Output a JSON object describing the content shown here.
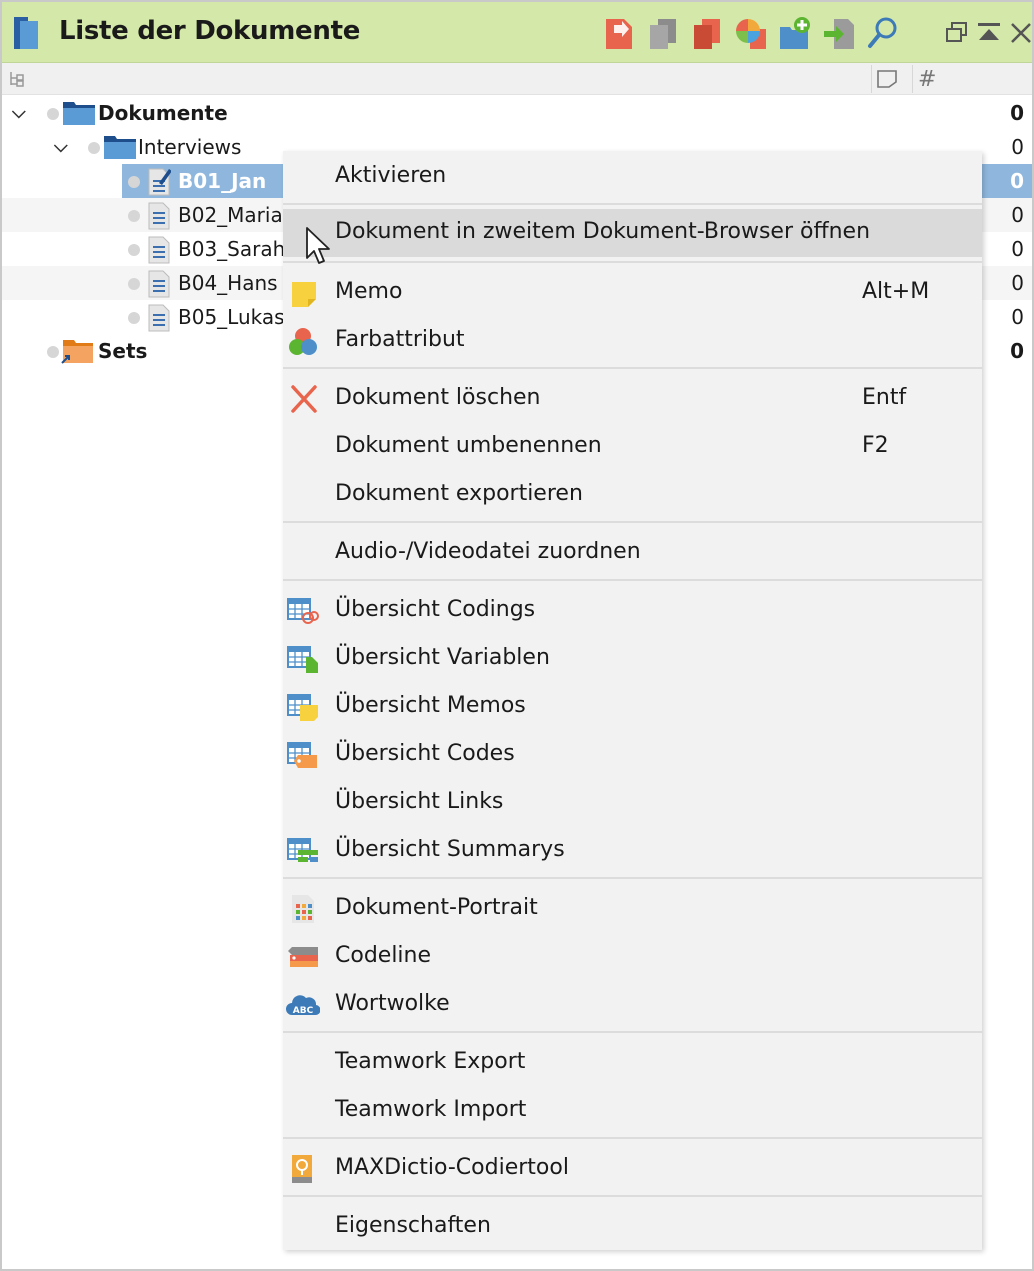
{
  "window": {
    "title": "Liste der Dokumente",
    "toolbar_icons": [
      "import-docs-icon",
      "copy-docs-icon",
      "duplicate-docs-icon",
      "document-portrait-chart-icon",
      "new-document-group-icon",
      "import-arrow-icon",
      "search-icon"
    ],
    "window_icons": [
      "restore-window-icon",
      "collapse-up-icon",
      "close-icon"
    ]
  },
  "columns": {
    "tree_icon": "tree-structure-icon",
    "memo_icon": "memo-column-icon",
    "count_icon": "#"
  },
  "tree": {
    "root": {
      "label": "Dokumente",
      "count": "0"
    },
    "group": {
      "label": "Interviews",
      "count": "0"
    },
    "documents": [
      {
        "label": "B01_Jan",
        "count": "0",
        "selected": true
      },
      {
        "label": "B02_Maria",
        "count": "0"
      },
      {
        "label": "B03_Sarah",
        "count": "0"
      },
      {
        "label": "B04_Hans",
        "count": "0"
      },
      {
        "label": "B05_Lukas",
        "count": "0"
      }
    ],
    "sets": {
      "label": "Sets",
      "count": "0"
    }
  },
  "menu": {
    "items": [
      {
        "label": "Aktivieren",
        "shortcut": "",
        "icon": ""
      },
      {
        "label": "Dokument in zweitem Dokument-Browser öffnen",
        "shortcut": "",
        "icon": "",
        "hover": true
      },
      {
        "label": "Memo",
        "shortcut": "Alt+M",
        "icon": "memo-icon"
      },
      {
        "label": "Farbattribut",
        "shortcut": "",
        "icon": "color-attribute-icon"
      },
      {
        "label": "Dokument löschen",
        "shortcut": "Entf",
        "icon": "delete-icon"
      },
      {
        "label": "Dokument umbenennen",
        "shortcut": "F2",
        "icon": ""
      },
      {
        "label": "Dokument exportieren",
        "shortcut": "",
        "icon": ""
      },
      {
        "label": "Audio-/Videodatei zuordnen",
        "shortcut": "",
        "icon": ""
      },
      {
        "label": "Übersicht Codings",
        "shortcut": "",
        "icon": "overview-codings-icon"
      },
      {
        "label": "Übersicht Variablen",
        "shortcut": "",
        "icon": "overview-variables-icon"
      },
      {
        "label": "Übersicht Memos",
        "shortcut": "",
        "icon": "overview-memos-icon"
      },
      {
        "label": "Übersicht Codes",
        "shortcut": "",
        "icon": "overview-codes-icon"
      },
      {
        "label": "Übersicht Links",
        "shortcut": "",
        "icon": ""
      },
      {
        "label": "Übersicht Summarys",
        "shortcut": "",
        "icon": "overview-summaries-icon"
      },
      {
        "label": "Dokument-Portrait",
        "shortcut": "",
        "icon": "document-portrait-icon"
      },
      {
        "label": "Codeline",
        "shortcut": "",
        "icon": "codeline-icon"
      },
      {
        "label": "Wortwolke",
        "shortcut": "",
        "icon": "word-cloud-icon"
      },
      {
        "label": "Teamwork Export",
        "shortcut": "",
        "icon": ""
      },
      {
        "label": "Teamwork Import",
        "shortcut": "",
        "icon": ""
      },
      {
        "label": "MAXDictio-Codiertool",
        "shortcut": "",
        "icon": "maxdictio-icon"
      },
      {
        "label": "Eigenschaften",
        "shortcut": "",
        "icon": ""
      }
    ]
  },
  "colors": {
    "titlebar": "#d3e8a9",
    "selection": "#8fb7dd",
    "menu_bg": "#f2f2f2",
    "menu_hover": "#dadada",
    "folder_blue": "#5b9bd5",
    "folder_orange": "#f4a460"
  }
}
